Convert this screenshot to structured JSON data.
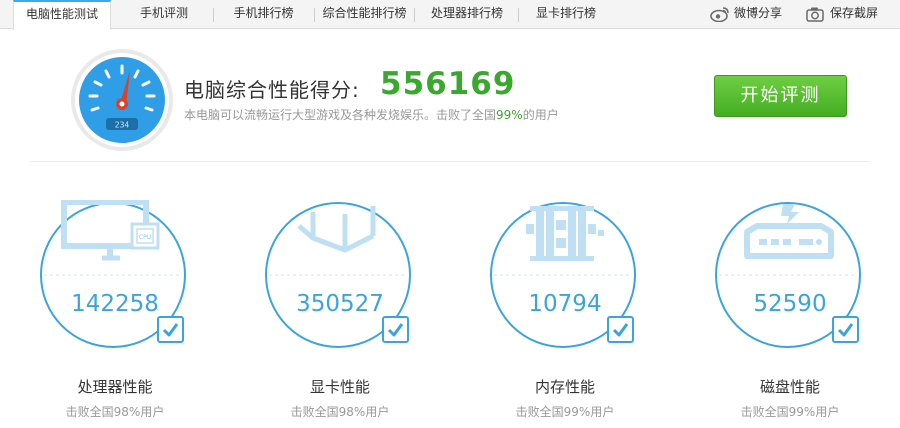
{
  "tabs": [
    {
      "label": "电脑性能测试",
      "active": true
    },
    {
      "label": "手机评测",
      "active": false
    },
    {
      "label": "手机排行榜",
      "active": false
    },
    {
      "label": "综合性能排行榜",
      "active": false
    },
    {
      "label": "处理器排行榜",
      "active": false
    },
    {
      "label": "显卡排行榜",
      "active": false
    }
  ],
  "tools": {
    "weibo_share": "微博分享",
    "save_screenshot": "保存截屏"
  },
  "score": {
    "title": "电脑综合性能得分:",
    "value": "556169",
    "subtitle_pre": "本电脑可以流畅运行大型游戏及各种发烧娱乐。击败了全国",
    "subtitle_pct": "99%",
    "subtitle_post": "的用户",
    "gauge_digits": "234"
  },
  "start_button": "开始评测",
  "colors": {
    "accent_blue": "#3ba4de",
    "score_green": "#3aa72f",
    "button_green": "#4fb82a",
    "gauge_needle": "#d9432c"
  },
  "cards": [
    {
      "icon": "monitor-cpu-icon",
      "value": "142258",
      "label": "处理器性能",
      "sub": "击败全国98%用户",
      "chip_text": "CPU"
    },
    {
      "icon": "graphics-cube-icon",
      "value": "350527",
      "label": "显卡性能",
      "sub": "击败全国98%用户"
    },
    {
      "icon": "memory-chip-icon",
      "value": "10794",
      "label": "内存性能",
      "sub": "击败全国99%用户"
    },
    {
      "icon": "hard-disk-icon",
      "value": "52590",
      "label": "磁盘性能",
      "sub": "击败全国99%用户"
    }
  ]
}
